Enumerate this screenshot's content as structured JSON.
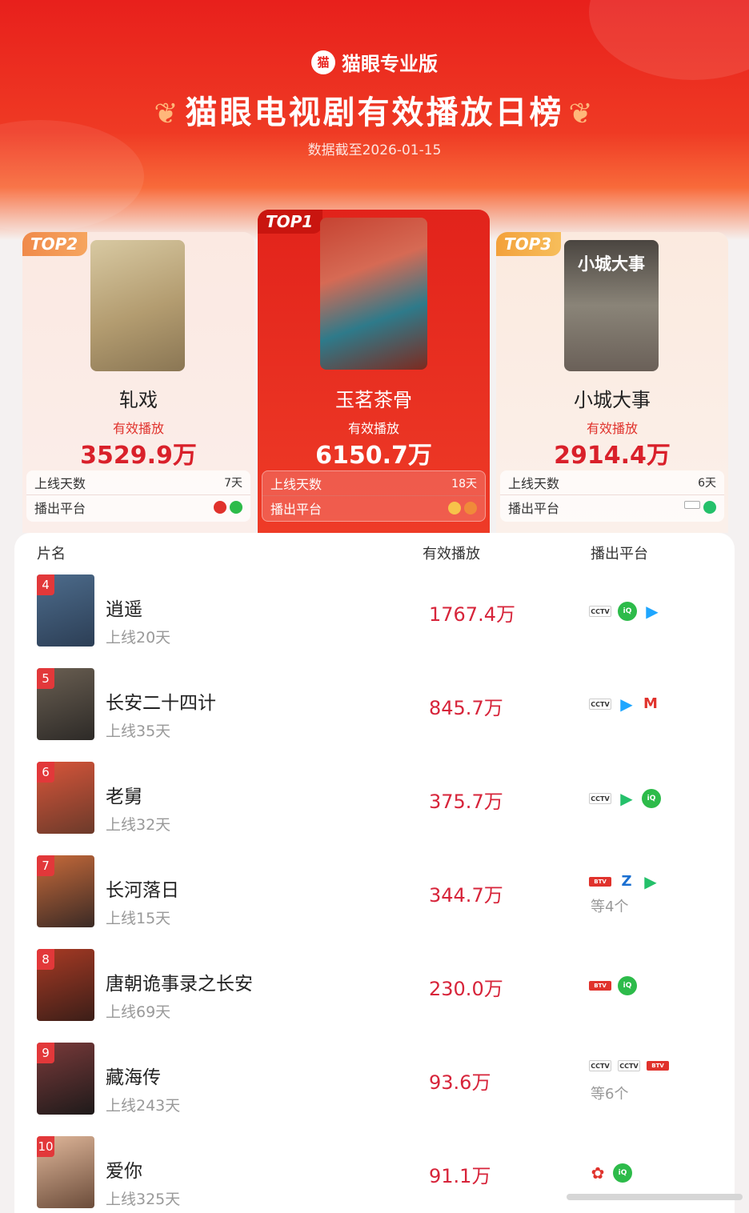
{
  "header": {
    "brand": "猫眼专业版",
    "brand_logo": "猫",
    "title": "猫眼电视剧有效播放日榜",
    "date": "数据截至2026-01-15"
  },
  "podium": {
    "top1": {
      "tag": "TOP1",
      "name": "玉茗茶骨",
      "metric_label": "有效播放",
      "value": "6150.7万",
      "days_label": "上线天数",
      "days": "18天",
      "platform_label": "播出平台",
      "platform_icons": [
        "mango-tv-icon",
        "youku-icon"
      ]
    },
    "top2": {
      "tag": "TOP2",
      "name": "轧戏",
      "metric_label": "有效播放",
      "value": "3529.9万",
      "days_label": "上线天数",
      "days": "7天",
      "platform_label": "播出平台",
      "platform_icons": [
        "sohu-icon",
        "iqiyi-icon"
      ]
    },
    "top3": {
      "tag": "TOP3",
      "name": "小城大事",
      "metric_label": "有效播放",
      "value": "2914.4万",
      "days_label": "上线天数",
      "days": "6天",
      "platform_label": "播出平台",
      "platform_icons": [
        "cctv-icon",
        "tencent-video-icon"
      ],
      "poster_text": "小城大事"
    }
  },
  "table": {
    "headers": {
      "name": "片名",
      "play": "有效播放",
      "platform": "播出平台"
    },
    "rows": [
      {
        "rank": "4",
        "title": "逍遥",
        "days": "上线20天",
        "value": "1767.4万",
        "more": ""
      },
      {
        "rank": "5",
        "title": "长安二十四计",
        "days": "上线35天",
        "value": "845.7万",
        "more": ""
      },
      {
        "rank": "6",
        "title": "老舅",
        "days": "上线32天",
        "value": "375.7万",
        "more": ""
      },
      {
        "rank": "7",
        "title": "长河落日",
        "days": "上线15天",
        "value": "344.7万",
        "more": "等4个"
      },
      {
        "rank": "8",
        "title": "唐朝诡事录之长安",
        "days": "上线69天",
        "value": "230.0万",
        "more": ""
      },
      {
        "rank": "9",
        "title": "藏海传",
        "days": "上线243天",
        "value": "93.6万",
        "more": "等6个"
      },
      {
        "rank": "10",
        "title": "爱你",
        "days": "上线325天",
        "value": "91.1万",
        "more": ""
      }
    ]
  },
  "colors": {
    "accent": "#e8201c",
    "value_red": "#d7243a",
    "iqiyi": "#2dbb4a",
    "youku": "#1ea6ff",
    "tencent": "#24c06a",
    "migu": "#e0322c"
  }
}
